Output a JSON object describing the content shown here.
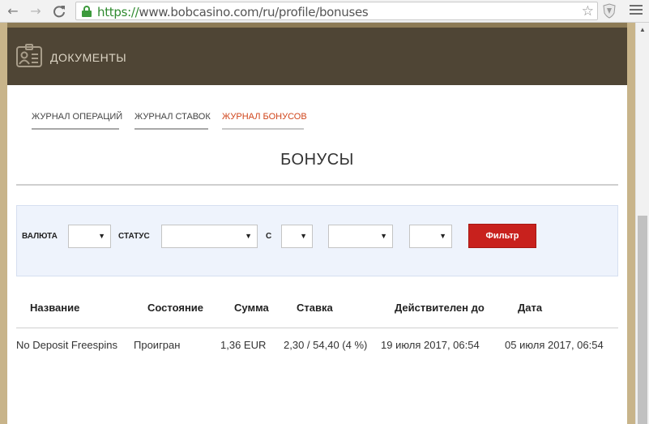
{
  "browser": {
    "url_scheme": "https://",
    "url_rest": "www.bobcasino.com/ru/profile/bonuses",
    "back_icon": "←",
    "forward_icon": "→",
    "reload_icon": "C",
    "star_icon": "☆"
  },
  "banner": {
    "title": "ДОКУМЕНТЫ"
  },
  "tabs": [
    {
      "label": "ЖУРНАЛ ОПЕРАЦИЙ",
      "active": false
    },
    {
      "label": "ЖУРНАЛ СТАВОК",
      "active": false
    },
    {
      "label": "ЖУРНАЛ БОНУСОВ",
      "active": true
    }
  ],
  "heading": "БОНУСЫ",
  "filter": {
    "currency_label": "ВАЛЮТА",
    "status_label": "СТАТУС",
    "from_label": "С",
    "currency_value": "",
    "status_value": "",
    "button_label": "Фильтр",
    "arrow": "▼"
  },
  "table": {
    "columns": [
      "Название",
      "Состояние",
      "Сумма",
      "Ставка",
      "Действителен до",
      "Дата"
    ],
    "rows": [
      {
        "name": "No Deposit Freespins",
        "state": "Проигран",
        "amount": "1,36 EUR",
        "stake": "2,30 / 54,40 (4 %)",
        "valid_until": "19 июля 2017, 06:54",
        "date": "05 июля 2017, 06:54"
      }
    ]
  },
  "colors": {
    "accent": "#d0451b",
    "button": "#c8211d",
    "banner": "#4f4535",
    "frame": "#c8b48a"
  }
}
